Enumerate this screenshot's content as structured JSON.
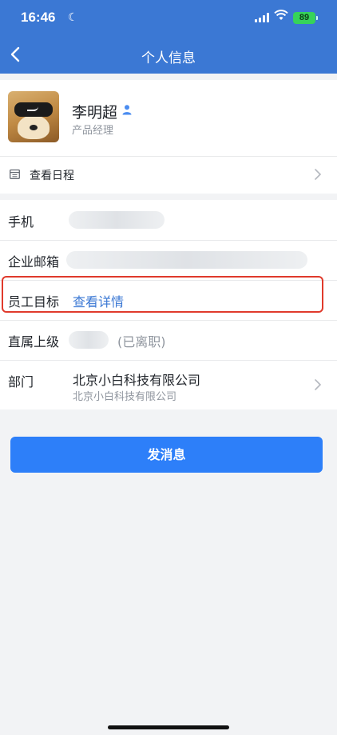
{
  "status_bar": {
    "time": "16:46",
    "battery": "89"
  },
  "nav": {
    "title": "个人信息"
  },
  "profile": {
    "name": "李明超",
    "role": "产品经理",
    "schedule_label": "查看日程"
  },
  "info": {
    "phone_label": "手机",
    "email_label": "企业邮箱",
    "goal_label": "员工目标",
    "goal_link": "查看详情",
    "manager_label": "直属上级",
    "manager_note": "(已离职)",
    "dept_label": "部门",
    "dept_name": "北京小白科技有限公司",
    "dept_path": "北京小白科技有限公司"
  },
  "actions": {
    "send_message": "发消息"
  },
  "colors": {
    "header": "#3b78d4",
    "link": "#3b78d4",
    "button": "#2d7ff9",
    "highlight": "#e03a2c"
  },
  "icons": [
    "moon-icon",
    "signal-icon",
    "wifi-icon",
    "battery-icon",
    "back-arrow-icon",
    "person-verified-icon",
    "calendar-icon",
    "chevron-right-icon"
  ]
}
